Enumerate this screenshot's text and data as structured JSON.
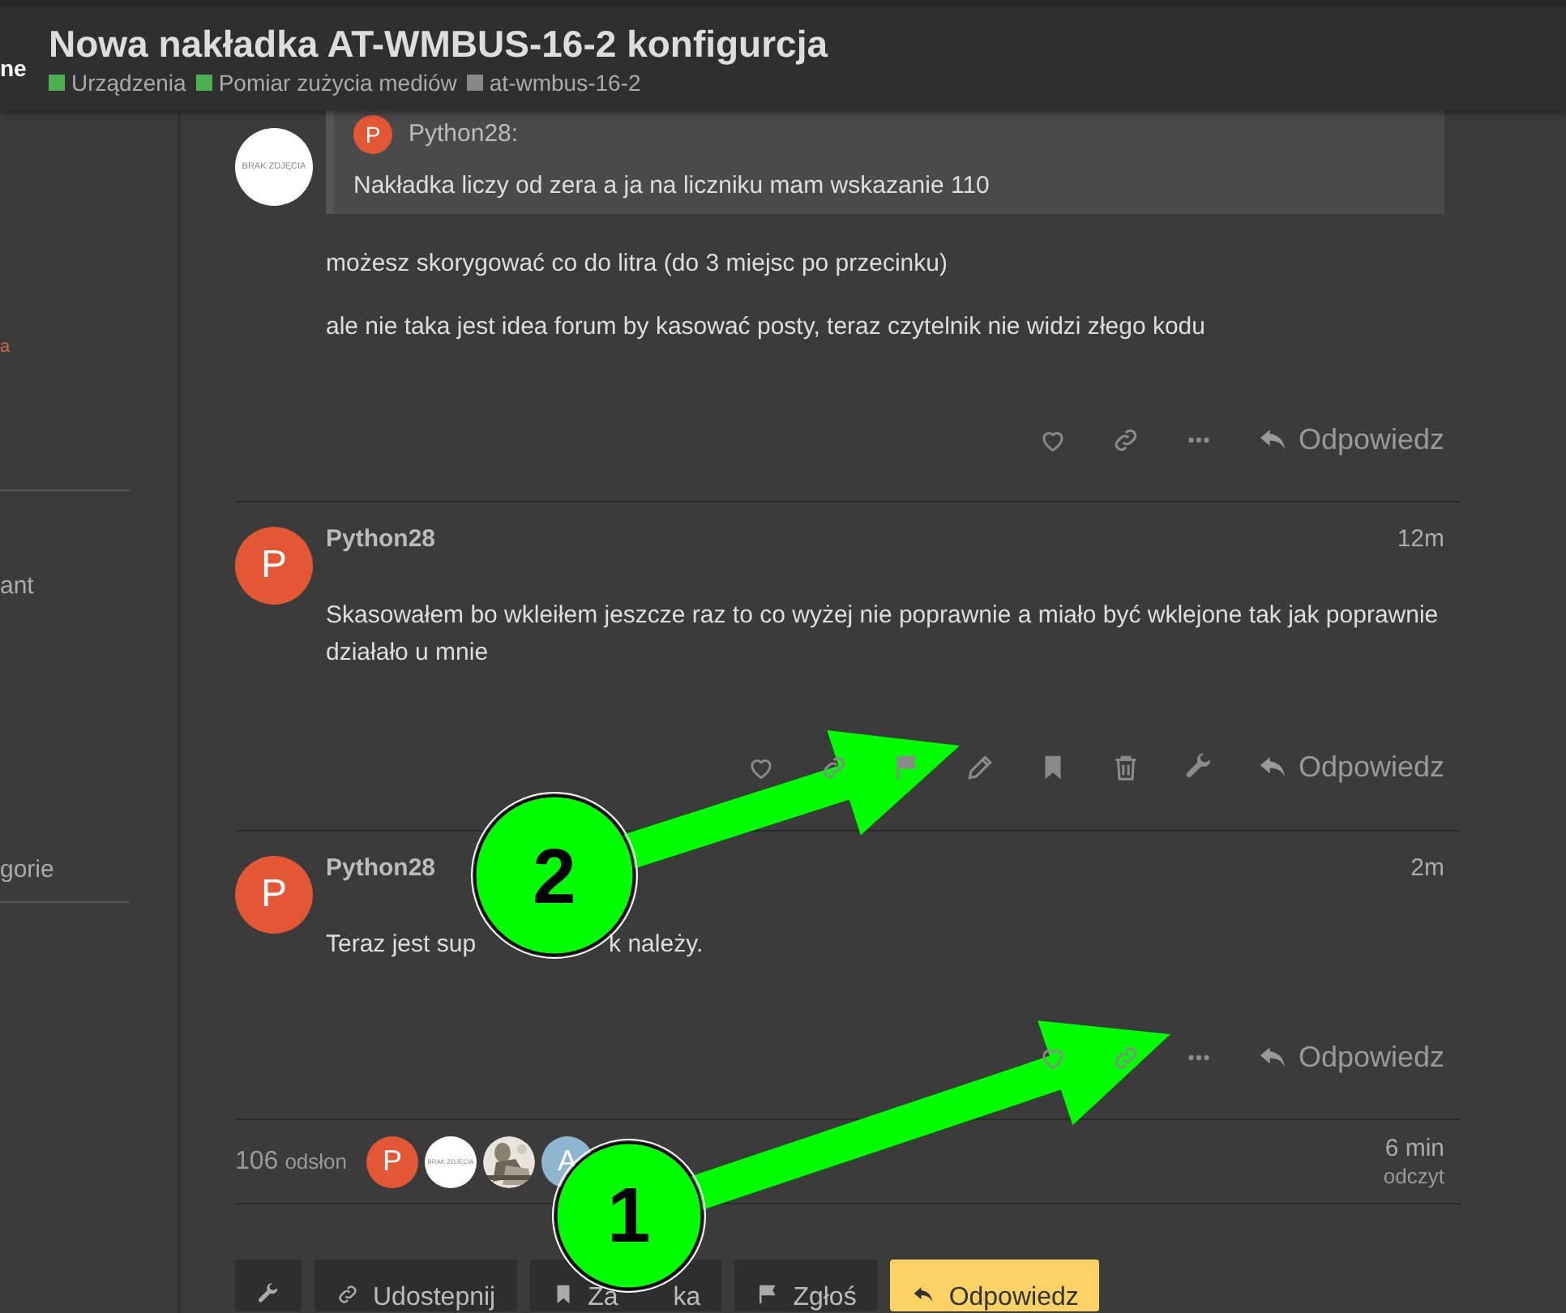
{
  "header": {
    "logo_fragment": "ne",
    "title": "Nowa nakładka AT-WMBUS-16-2 konfigurcja",
    "breadcrumbs": [
      {
        "label": "Urządzenia",
        "color": "#4caf50"
      },
      {
        "label": "Pomiar zużycia mediów",
        "color": "#4caf50"
      },
      {
        "label": "at-wmbus-16-2",
        "color": "#888888"
      }
    ]
  },
  "sidebar": {
    "items": [
      {
        "text": "a",
        "kind": "accent"
      },
      {
        "text": "ant",
        "kind": "link"
      },
      {
        "text": "gorie",
        "kind": "link"
      }
    ]
  },
  "posts": [
    {
      "avatar": {
        "kind": "no-photo",
        "label": "BRAK ZDJĘCIA"
      },
      "quote": {
        "author": "Python28:",
        "avatar_letter": "P",
        "text": "Nakładka liczy od zera a ja na liczniku mam wskazanie 110"
      },
      "paragraphs": [
        [
          "możesz skorygować co do litra (do 3 miejsc po przecinku)"
        ],
        [
          "ale nie taka jest idea forum by kasować posty, teraz czytelnik nie widzi złego kodu"
        ]
      ],
      "actions": [
        {
          "kind": "like"
        },
        {
          "kind": "link"
        },
        {
          "kind": "more"
        }
      ],
      "reply": "Odpowiedz"
    },
    {
      "avatar": {
        "kind": "letter",
        "label": "P"
      },
      "author": "Python28",
      "time": "12m",
      "paragraphs": [
        [
          "Skasowałem bo wkleiłem jeszcze raz to co wyżej nie poprawnie a miało być wklejone tak jak poprawnie działało u mnie"
        ]
      ],
      "actions": [
        {
          "kind": "like"
        },
        {
          "kind": "link"
        },
        {
          "kind": "flag"
        },
        {
          "kind": "edit"
        },
        {
          "kind": "bookmark"
        },
        {
          "kind": "delete"
        },
        {
          "kind": "wrench"
        }
      ],
      "reply": "Odpowiedz"
    },
    {
      "avatar": {
        "kind": "letter",
        "label": "P"
      },
      "author": "Python28",
      "time": "2m",
      "paragraphs": [
        [
          "Teraz jest sup",
          "k należy."
        ]
      ],
      "actions": [
        {
          "kind": "like"
        },
        {
          "kind": "link"
        },
        {
          "kind": "more"
        }
      ],
      "reply": "Odpowiedz"
    }
  ],
  "topic_map": {
    "views": "106",
    "views_label": "odsłon",
    "participants": [
      {
        "kind": "letter",
        "label": "P",
        "color": "#e45735"
      },
      {
        "kind": "no-photo",
        "label": "BRAK ZDJĘCIA"
      },
      {
        "kind": "picture"
      },
      {
        "kind": "letter",
        "label": "A",
        "color": "#8fb5d0"
      }
    ],
    "read_time": "6 min",
    "read_label": "odczyt"
  },
  "footer_buttons": [
    {
      "kind": "wrench"
    },
    {
      "kind": "link",
      "label": [
        "Udostepnij"
      ]
    },
    {
      "kind": "bookmark",
      "label": [
        "Za",
        "ka"
      ]
    },
    {
      "kind": "flag",
      "label": [
        "Zgłoś"
      ]
    },
    {
      "kind": "reply",
      "label": [
        "Odpowiedz"
      ]
    }
  ],
  "annotations": [
    {
      "label": "2"
    },
    {
      "label": "1"
    }
  ]
}
